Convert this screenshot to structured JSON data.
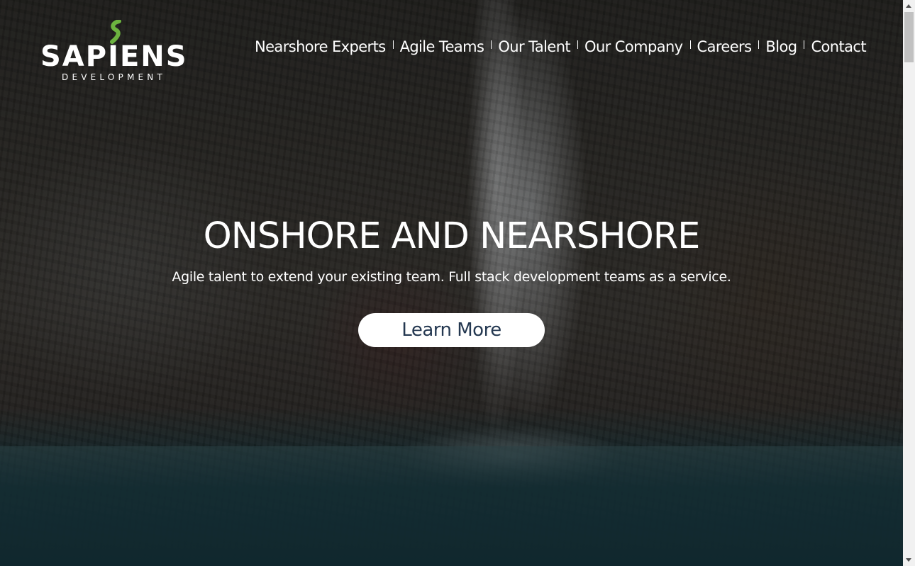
{
  "brand": {
    "name": "SAPIENS",
    "tagline": "DEVELOPMENT",
    "accent_color": "#6cb33f"
  },
  "nav": {
    "items": [
      {
        "label": "Nearshore Experts"
      },
      {
        "label": "Agile Teams"
      },
      {
        "label": "Our Talent"
      },
      {
        "label": "Our Company"
      },
      {
        "label": "Careers"
      },
      {
        "label": "Blog"
      },
      {
        "label": "Contact"
      }
    ]
  },
  "hero": {
    "headline": "ONSHORE AND NEARSHORE",
    "subline": "Agile talent to extend your existing team. Full stack development teams as a service.",
    "cta_label": "Learn More",
    "cta_text_color": "#243851"
  }
}
